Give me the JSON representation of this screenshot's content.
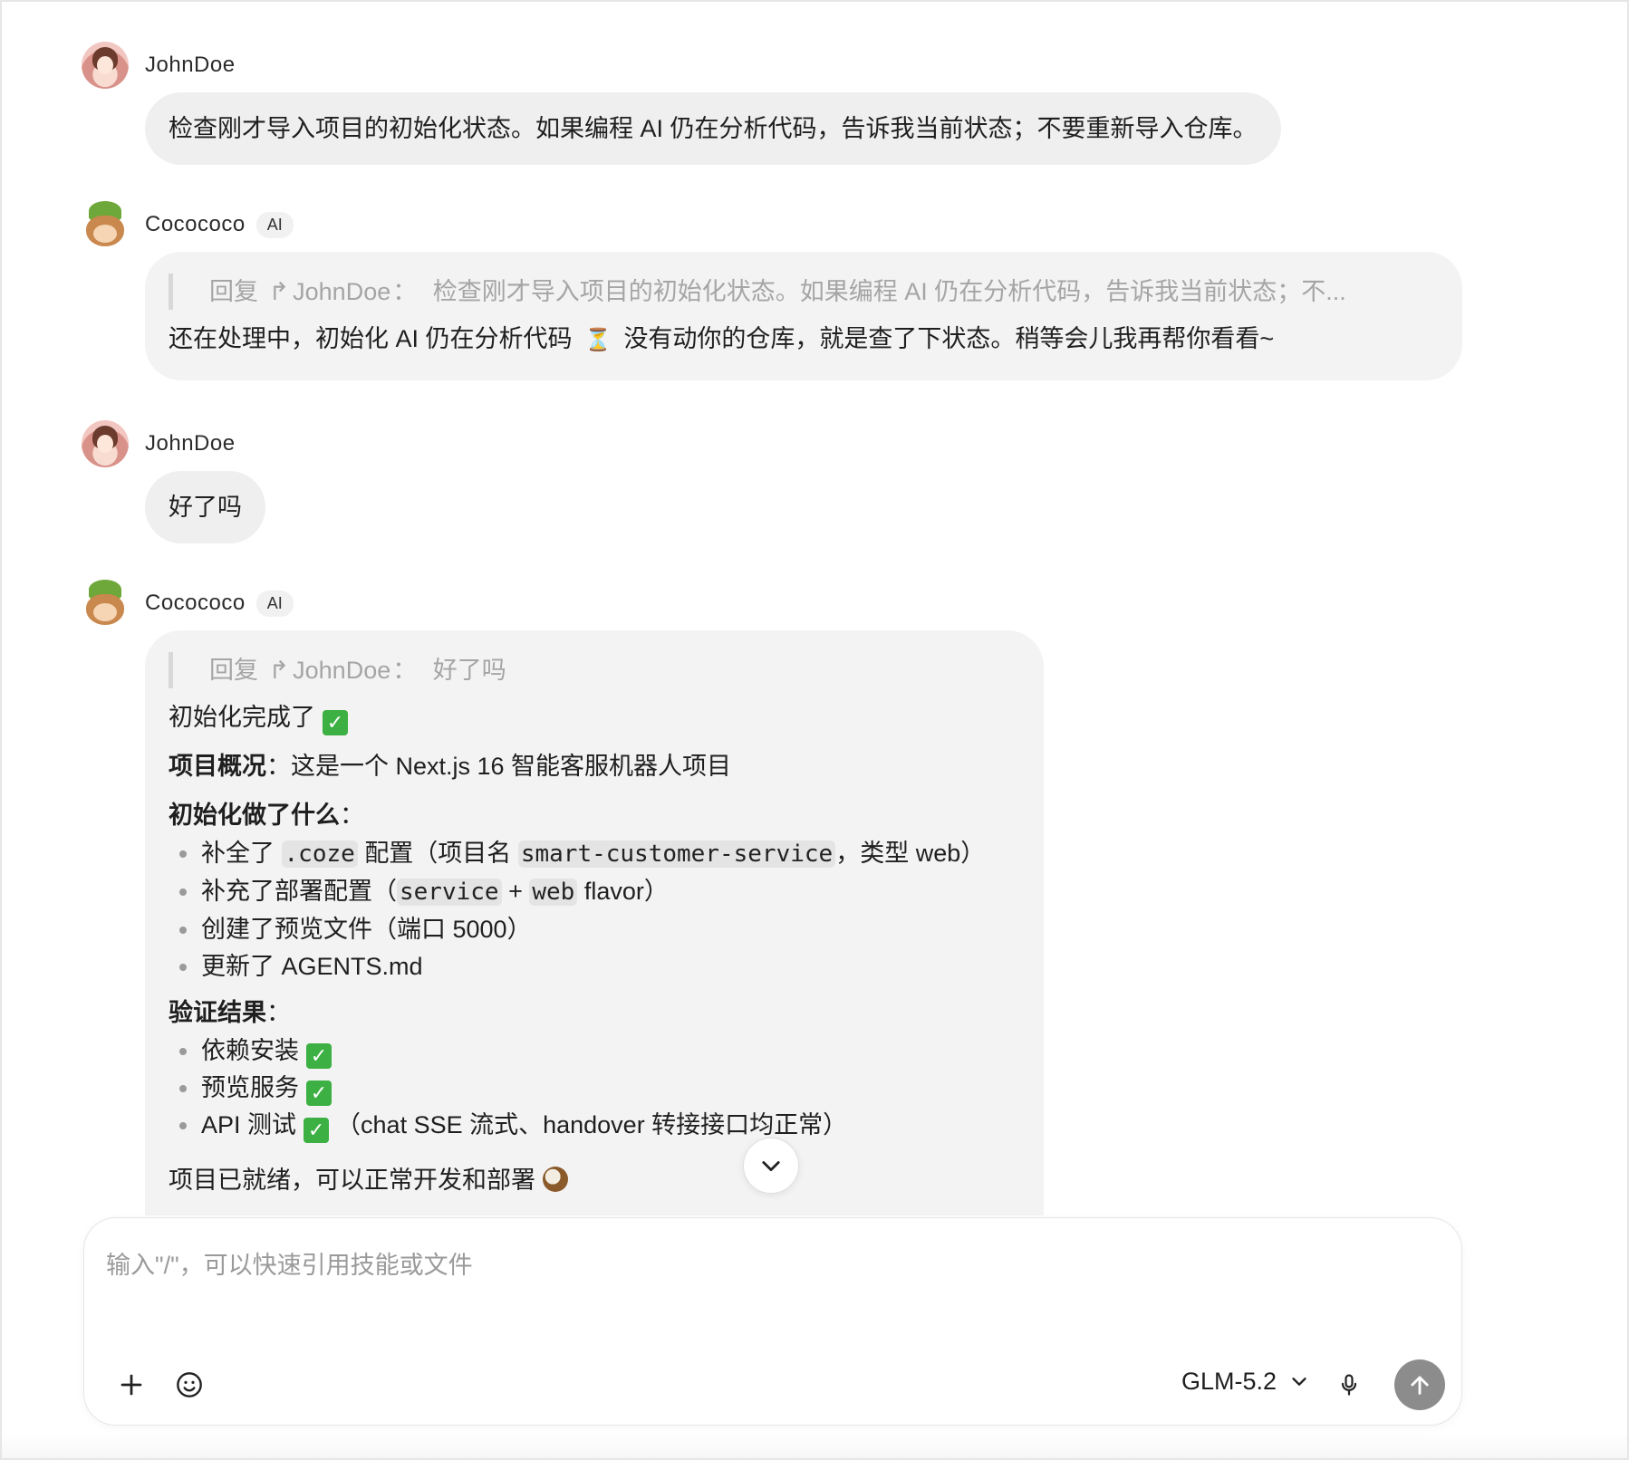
{
  "messages": [
    {
      "author": "JohnDoe",
      "text": "检查刚才导入项目的初始化状态。如果编程 AI 仍在分析代码，告诉我当前状态；不要重新导入仓库。"
    },
    {
      "author": "Cocococo",
      "badge": "AI",
      "reply_prefix": "回复",
      "reply_arrow": "↱",
      "reply_to": "JohnDoe",
      "reply_sep": "：",
      "reply_quote": "检查刚才导入项目的初始化状态。如果编程 AI 仍在分析代码，告诉我当前状态；不...",
      "text_before": "还在处理中，初始化 AI 仍在分析代码",
      "text_after": "没有动你的仓库，就是查了下状态。稍等会儿我再帮你看看~"
    },
    {
      "author": "JohnDoe",
      "text": "好了吗"
    },
    {
      "author": "Cocococo",
      "badge": "AI",
      "reply_prefix": "回复",
      "reply_arrow": "↱",
      "reply_to": "JohnDoe",
      "reply_sep": "：",
      "reply_quote": "好了吗",
      "done_line": "初始化完成了",
      "overview_label": "项目概况",
      "overview_sep": "：",
      "overview_text": "这是一个 Next.js 16 智能客服机器人项目",
      "did_label": "初始化做了什么",
      "did_sep": "：",
      "did_items": [
        {
          "pre": "补全了",
          "code": ".coze",
          "mid": "配置（项目名",
          "code2": "smart-customer-service",
          "post": "，类型 web）"
        },
        {
          "pre": "补充了部署配置（",
          "code": "service",
          "mid": " + ",
          "code2": "web",
          "post": " flavor）"
        },
        {
          "pre": "创建了预览文件（端口 5000）"
        },
        {
          "pre": "更新了 AGENTS.md"
        }
      ],
      "verify_label": "验证结果",
      "verify_sep": "：",
      "verify_items": [
        {
          "text": "依赖安装"
        },
        {
          "text": "预览服务"
        },
        {
          "text": "API 测试",
          "after": "（chat SSE 流式、handover 转接接口均正常）"
        }
      ],
      "ready_line": "项目已就绪，可以正常开发和部署"
    }
  ],
  "composer": {
    "placeholder": "输入\"/\"，可以快速引用技能或文件",
    "model": "GLM-5.2"
  },
  "icons": {
    "check": "✓",
    "hourglass": "⏳",
    "add": "plus-icon",
    "emoji": "emoji-icon",
    "mic": "microphone-icon",
    "send": "arrow-up-icon",
    "scroll": "chevron-down-icon"
  },
  "colors": {
    "bubble": "#efefef",
    "send_button": "#8c8c8c",
    "check": "#3cb043"
  }
}
